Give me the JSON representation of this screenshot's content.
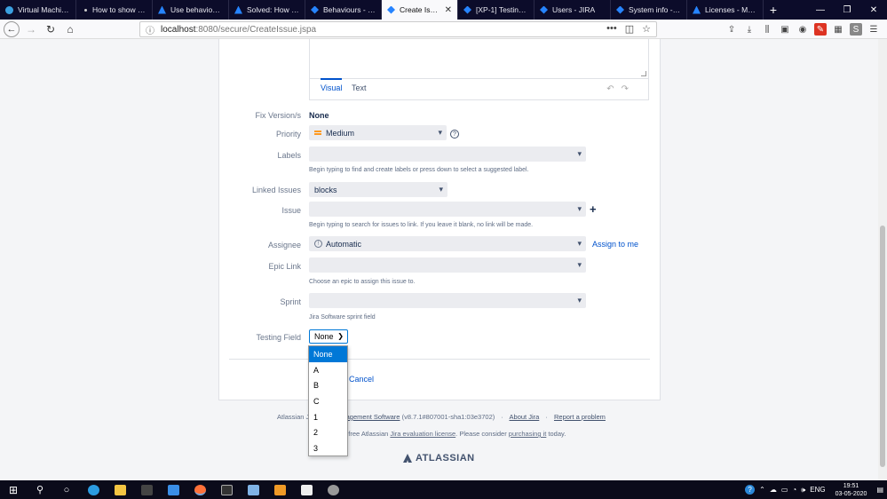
{
  "browser": {
    "tabs": [
      {
        "title": "Virtual Machines",
        "icon": "edge-icon",
        "active": false
      },
      {
        "title": "How to show valu",
        "icon": "dot-icon",
        "active": false
      },
      {
        "title": "Use behaviour to",
        "icon": "atlassian-icon",
        "active": false
      },
      {
        "title": "Solved: How to d",
        "icon": "atlassian-icon",
        "active": false
      },
      {
        "title": "Behaviours - JIRA",
        "icon": "jira-icon",
        "active": false
      },
      {
        "title": "Create Issue - ",
        "icon": "jira-icon",
        "active": true
      },
      {
        "title": "[XP-1] Testing wo",
        "icon": "jira-icon",
        "active": false
      },
      {
        "title": "Users - JIRA",
        "icon": "jira-icon",
        "active": false
      },
      {
        "title": "System info - JIRA",
        "icon": "jira-icon",
        "active": false
      },
      {
        "title": "Licenses - My Atla",
        "icon": "atlassian-icon",
        "active": false
      }
    ],
    "new_tab": "+",
    "url_host": "localhost",
    "url_rest": ":8080/secure/CreateIssue.jspa"
  },
  "editor": {
    "tab_visual": "Visual",
    "tab_text": "Text"
  },
  "form": {
    "fix_version": {
      "label": "Fix Version/s",
      "value": "None"
    },
    "priority": {
      "label": "Priority",
      "value": "Medium",
      "help": "?"
    },
    "labels": {
      "label": "Labels",
      "value": "",
      "hint": "Begin typing to find and create labels or press down to select a suggested label."
    },
    "linked_issues": {
      "label": "Linked Issues",
      "value": "blocks"
    },
    "issue": {
      "label": "Issue",
      "value": "",
      "hint": "Begin typing to search for issues to link. If you leave it blank, no link will be made.",
      "add": "+"
    },
    "assignee": {
      "label": "Assignee",
      "value": "Automatic",
      "assign_to_me": "Assign to me"
    },
    "epic_link": {
      "label": "Epic Link",
      "value": "",
      "hint": "Choose an epic to assign this issue to."
    },
    "sprint": {
      "label": "Sprint",
      "value": "",
      "hint": "Jira Software sprint field"
    },
    "testing_field": {
      "label": "Testing Field",
      "value": "None",
      "options": [
        "None",
        "A",
        "B",
        "C",
        "1",
        "2",
        "3"
      ],
      "selected_index": 0
    },
    "cancel": "Cancel"
  },
  "footer": {
    "line1_prefix": "Atlassian Jir",
    "line1_link": "nagement Software",
    "line1_version": " (v8.7.1#807001-sha1:03e3702)",
    "sep": "·",
    "about": "About Jira",
    "report": "Report a problem",
    "line2_prefix": "a free Atlassian ",
    "line2_license": "Jira evaluation license",
    "line2_mid": ". Please consider ",
    "line2_purchase": "purchasing it",
    "line2_suffix": " today.",
    "logo": "ATLASSIAN"
  },
  "taskbar": {
    "lang": "ENG",
    "time": "19:51",
    "date": "03-05-2020"
  },
  "colors": {
    "link": "#0052cc",
    "accent_blue": "#0078d7",
    "priority_medium": "#ff991f"
  }
}
